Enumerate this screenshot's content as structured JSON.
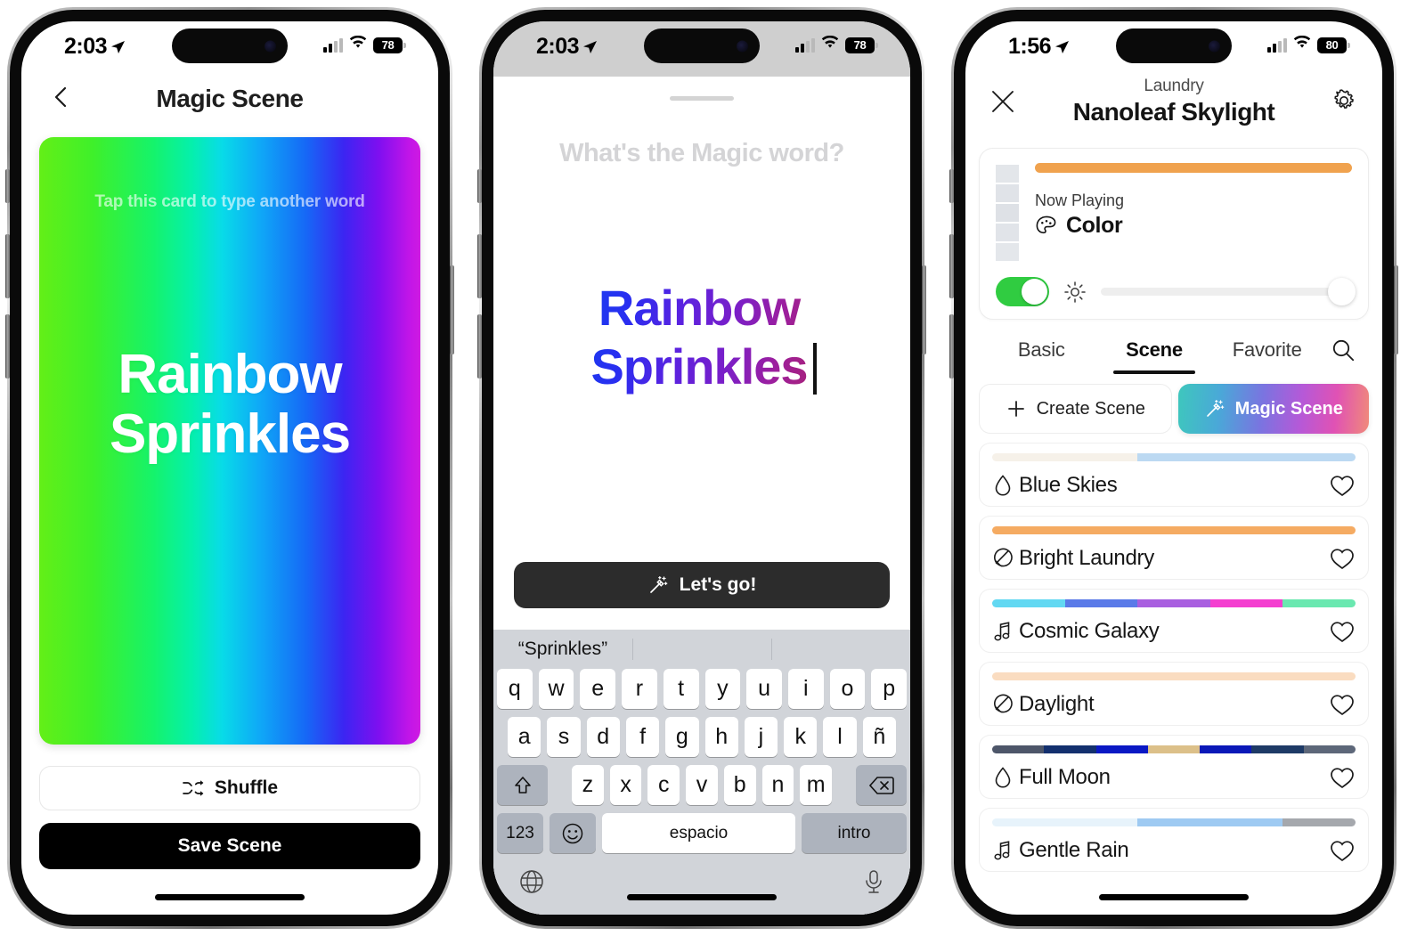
{
  "phones": [
    {
      "status": {
        "time": "2:03",
        "battery": "78",
        "location_icon": "location-arrow-icon",
        "cell_icon": "cellular-bars-icon",
        "wifi_icon": "wifi-icon"
      },
      "nav": {
        "back_icon": "chevron-left-icon",
        "title": "Magic Scene"
      },
      "card": {
        "hint": "Tap this card to type another word",
        "word_line1": "Rainbow",
        "word_line2": "Sprinkles",
        "gradient": [
          "#63ef17",
          "#15f36b",
          "#08dbe8",
          "#1668f6",
          "#7e0ff0",
          "#cf1ae2"
        ]
      },
      "shuffle_label": "Shuffle",
      "shuffle_icon": "shuffle-icon",
      "save_label": "Save Scene"
    },
    {
      "status": {
        "time": "2:03",
        "battery": "78",
        "location_icon": "location-arrow-icon",
        "cell_icon": "cellular-bars-icon",
        "wifi_icon": "wifi-icon"
      },
      "sheet": {
        "placeholder_prompt": "What's the Magic word?",
        "typed_line1": "Rainbow",
        "typed_line2": "Sprinkles",
        "typed_gradient": [
          "#1a3bf0",
          "#5a22e0",
          "#9c1f9e",
          "#a82277"
        ],
        "go_label": "Let's go!",
        "go_icon": "magic-wand-icon"
      },
      "keyboard": {
        "suggestion": "“Sprinkles”",
        "row1": [
          "q",
          "w",
          "e",
          "r",
          "t",
          "y",
          "u",
          "i",
          "o",
          "p"
        ],
        "row2": [
          "a",
          "s",
          "d",
          "f",
          "g",
          "h",
          "j",
          "k",
          "l",
          "ñ"
        ],
        "row3": [
          "z",
          "x",
          "c",
          "v",
          "b",
          "n",
          "m"
        ],
        "shift_icon": "shift-up-icon",
        "backspace_icon": "backspace-icon",
        "numbers_label": "123",
        "emoji_icon": "smiley-icon",
        "space_label": "espacio",
        "return_label": "intro",
        "globe_icon": "globe-icon",
        "mic_icon": "microphone-icon"
      }
    },
    {
      "status": {
        "time": "1:56",
        "battery": "80",
        "location_icon": "location-arrow-icon",
        "cell_icon": "cellular-bars-icon",
        "wifi_icon": "wifi-icon"
      },
      "nav": {
        "close_icon": "close-x-icon",
        "gear_icon": "gear-icon",
        "room": "Laundry",
        "device": "Nanoleaf Skylight"
      },
      "now_playing": {
        "bar_color": "#f0a24e",
        "label": "Now Playing",
        "value": "Color",
        "value_icon": "palette-icon",
        "power_on": true,
        "brightness_icon": "brightness-icon",
        "brightness_percent": 100
      },
      "tabs": [
        {
          "label": "Basic",
          "active": false
        },
        {
          "label": "Scene",
          "active": true
        },
        {
          "label": "Favorite",
          "active": false
        }
      ],
      "search_icon": "search-icon",
      "actions": {
        "create_label": "Create Scene",
        "create_icon": "plus-icon",
        "magic_label": "Magic Scene",
        "magic_icon": "magic-wand-icon"
      },
      "scenes": [
        {
          "name": "Blue Skies",
          "icon": "droplet-icon",
          "colors": [
            "#f6f1e9",
            "#f6f1e9",
            "#bcd9f2",
            "#bcd9f2",
            "#bcd9f2"
          ]
        },
        {
          "name": "Bright Laundry",
          "icon": "palette-tilt-icon",
          "colors": [
            "#f5ab62",
            "#f5ab62",
            "#f5ab62",
            "#f5ab62",
            "#f5ab62"
          ]
        },
        {
          "name": "Cosmic Galaxy",
          "icon": "music-note-icon",
          "colors": [
            "#62d8f2",
            "#5a7ae8",
            "#a95fe0",
            "#f43fd0",
            "#6ae8b0"
          ]
        },
        {
          "name": "Daylight",
          "icon": "palette-tilt-icon",
          "colors": [
            "#fadcc0",
            "#fadcc0",
            "#fadcc0",
            "#fadcc0",
            "#fadcc0"
          ]
        },
        {
          "name": "Full Moon",
          "icon": "droplet-icon",
          "colors": [
            "#4d5669",
            "#13306e",
            "#0a18c4",
            "#dcc089",
            "#0a18b8",
            "#1e3a66",
            "#5d6779"
          ]
        },
        {
          "name": "Gentle Rain",
          "icon": "music-note-icon",
          "colors": [
            "#e7f3fb",
            "#e7f3fb",
            "#9ecaf2",
            "#9ecaf2",
            "#a5a8ad"
          ]
        }
      ],
      "favorite_icon": "heart-outline-icon"
    }
  ]
}
